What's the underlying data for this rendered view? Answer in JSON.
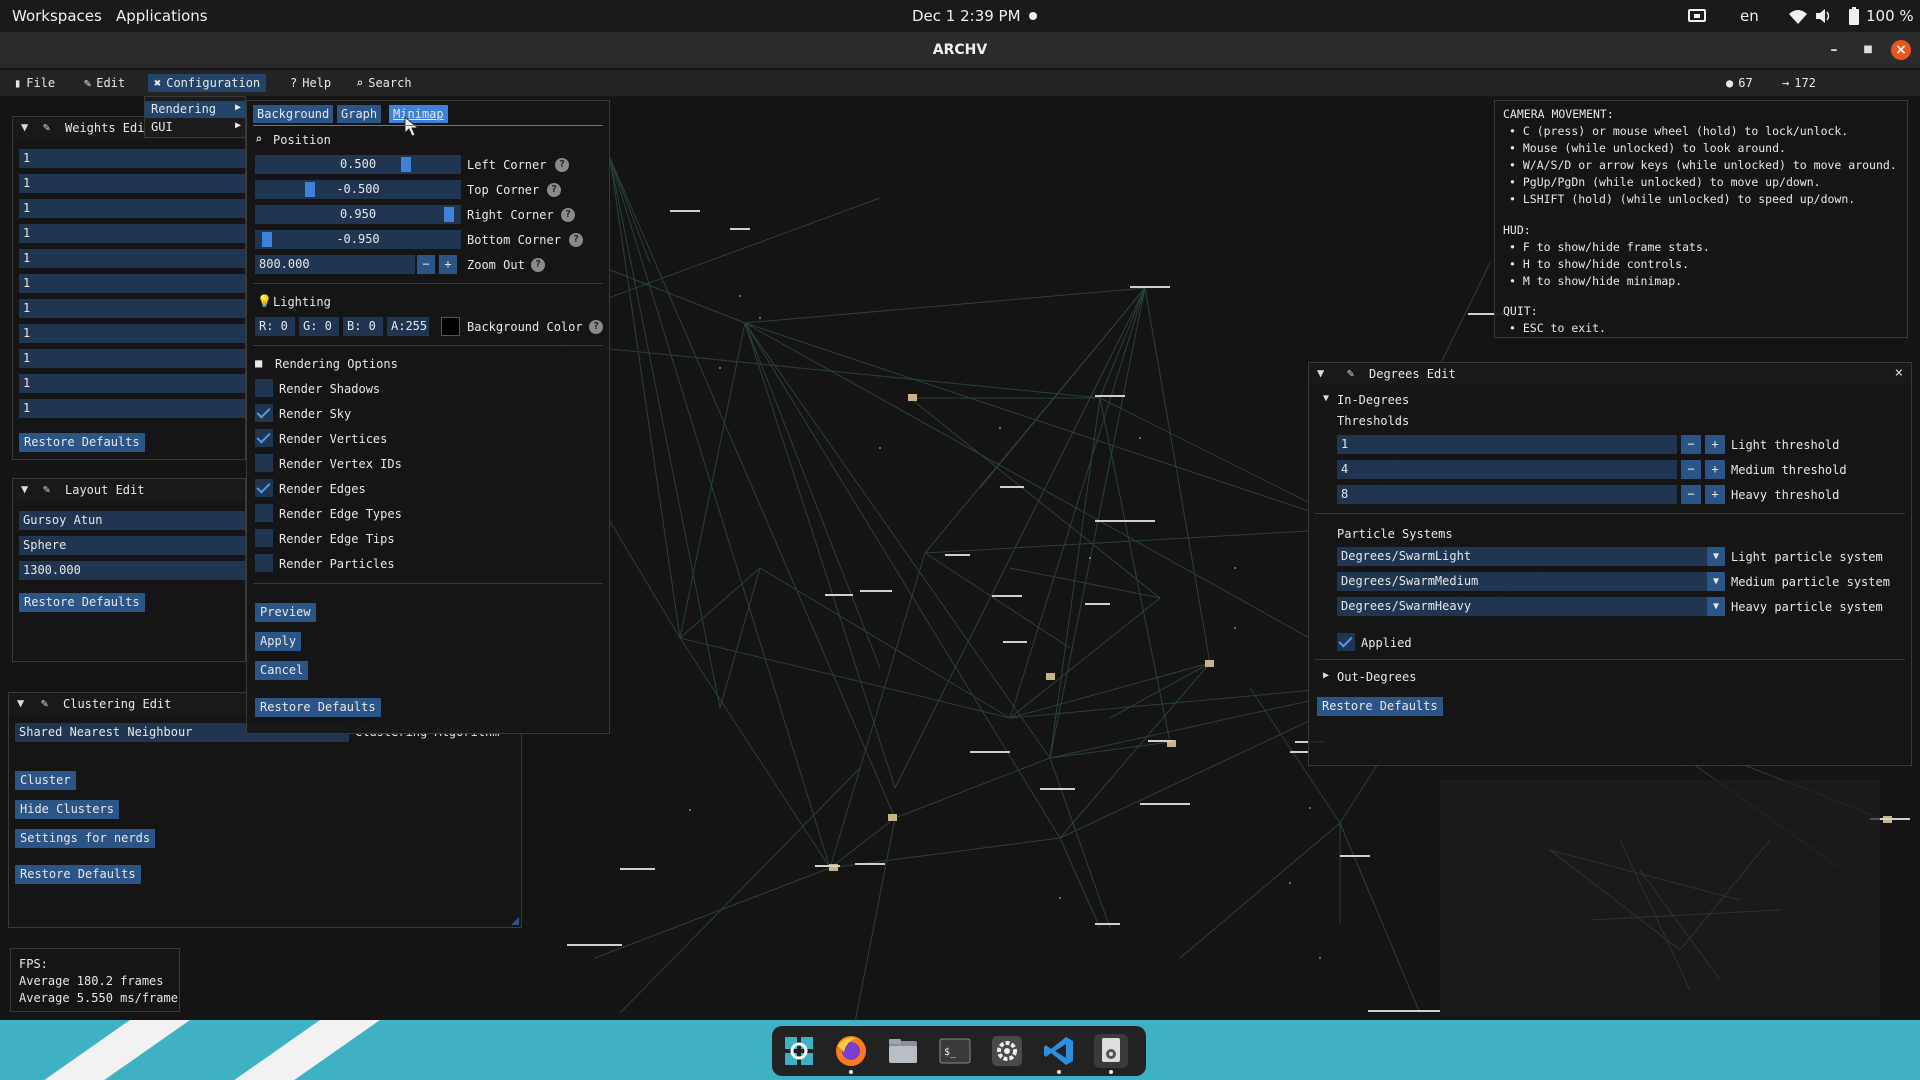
{
  "topbar": {
    "workspaces": "Workspaces",
    "applications": "Applications",
    "clock": "Dec 1  2:39 PM",
    "language": "en",
    "battery": "100 %"
  },
  "window": {
    "title": "ARCHV"
  },
  "menu": {
    "file": "File",
    "edit": "Edit",
    "configuration": "Configuration",
    "help": "Help",
    "search": "Search",
    "vertex_count": "67",
    "edge_count": "172"
  },
  "config_submenu": {
    "rendering": "Rendering",
    "gui": "GUI"
  },
  "weights_edit": {
    "title": "Weights Edi",
    "values": [
      "1",
      "1",
      "1",
      "1",
      "1",
      "1",
      "1",
      "1",
      "1",
      "1",
      "1"
    ],
    "restore": "Restore Defaults"
  },
  "layout_edit": {
    "title": "Layout Edit",
    "algorithm": "Gursoy Atun",
    "topology": "Sphere",
    "scale": "1300.000",
    "restore": "Restore Defaults"
  },
  "clustering_edit": {
    "title": "Clustering Edit",
    "algorithm": "Shared Nearest Neighbour",
    "algorithm_label": "Clustering Algorithm",
    "cluster": "Cluster",
    "hide_clusters": "Hide Clusters",
    "settings": "Settings for nerds",
    "restore": "Restore Defaults"
  },
  "rendering_popup": {
    "tabs": [
      "Background",
      "Graph",
      "Minimap"
    ],
    "active_tab": "Minimap",
    "position_header": "Position",
    "sliders": [
      {
        "value": "0.500",
        "label": "Left Corner",
        "level": 0.75
      },
      {
        "value": "-0.500",
        "label": "Top Corner",
        "level": 0.25
      },
      {
        "value": "0.950",
        "label": "Right Corner",
        "level": 0.975
      },
      {
        "value": "-0.950",
        "label": "Bottom Corner",
        "level": 0.025
      }
    ],
    "zoom_value": "800.000",
    "zoom_label": "Zoom Out",
    "lighting_header": "Lighting",
    "color": {
      "r": "R:  0",
      "g": "G:  0",
      "b": "B:  0",
      "a": "A:255",
      "label": "Background Color",
      "swatch": "#000000"
    },
    "options_header": "Rendering Options",
    "options": [
      {
        "label": "Render Shadows",
        "checked": false
      },
      {
        "label": "Render Sky",
        "checked": true
      },
      {
        "label": "Render Vertices",
        "checked": true
      },
      {
        "label": "Render Vertex IDs",
        "checked": false
      },
      {
        "label": "Render Edges",
        "checked": true
      },
      {
        "label": "Render Edge Types",
        "checked": false
      },
      {
        "label": "Render Edge Tips",
        "checked": false
      },
      {
        "label": "Render Particles",
        "checked": false
      }
    ],
    "preview": "Preview",
    "apply": "Apply",
    "cancel": "Cancel",
    "restore": "Restore Defaults"
  },
  "controls": {
    "camera_header": "CAMERA MOVEMENT:",
    "camera": [
      "C (press) or mouse wheel (hold) to lock/unlock.",
      "Mouse (while unlocked) to look around.",
      "W/A/S/D or arrow keys (while unlocked) to move around.",
      "PgUp/PgDn (while unlocked) to move up/down.",
      "LSHIFT (hold) (while unlocked) to speed up/down."
    ],
    "hud_header": "HUD:",
    "hud": [
      "F to show/hide frame stats.",
      "H to show/hide controls.",
      "M to show/hide minimap."
    ],
    "quit_header": "QUIT:",
    "quit": [
      "ESC to exit."
    ]
  },
  "degrees_edit": {
    "title": "Degrees Edit",
    "in_degrees": "In-Degrees",
    "thresholds": "Thresholds",
    "threshold_rows": [
      {
        "value": "1",
        "label": "Light threshold"
      },
      {
        "value": "4",
        "label": "Medium threshold"
      },
      {
        "value": "8",
        "label": "Heavy threshold"
      }
    ],
    "particle_header": "Particle Systems",
    "particle_rows": [
      {
        "value": "Degrees/SwarmLight",
        "label": "Light particle system"
      },
      {
        "value": "Degrees/SwarmMedium",
        "label": "Medium particle system"
      },
      {
        "value": "Degrees/SwarmHeavy",
        "label": "Heavy particle system"
      }
    ],
    "applied": "Applied",
    "out_degrees": "Out-Degrees",
    "restore": "Restore Defaults"
  },
  "fps": {
    "header": "FPS:",
    "frames": "Average 180.2 frames",
    "ms": "Average 5.550 ms/frame"
  },
  "dock": {
    "apps": [
      "search-app-icon",
      "firefox-icon",
      "files-icon",
      "terminal-icon",
      "settings-icon",
      "vscode-icon",
      "archv-icon"
    ]
  },
  "colors": {
    "accent": "#3f80d8",
    "field": "#1f3550",
    "button": "#2b5586",
    "dock_bg": "#3eb1c4",
    "close": "#e95420"
  }
}
